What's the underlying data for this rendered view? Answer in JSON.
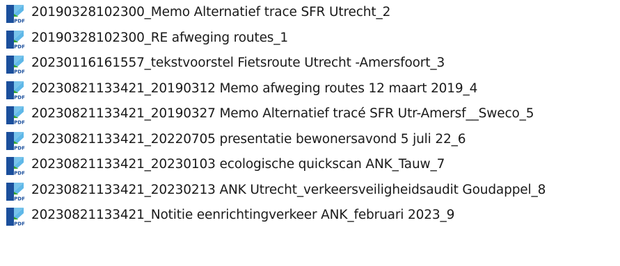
{
  "files": [
    {
      "name": "20190328102300_Memo Alternatief trace SFR Utrecht_2",
      "icon": "pdf-file-icon"
    },
    {
      "name": "20190328102300_RE afweging routes_1",
      "icon": "pdf-file-icon"
    },
    {
      "name": "20230116161557_tekstvoorstel Fietsroute Utrecht -Amersfoort_3",
      "icon": "pdf-file-icon"
    },
    {
      "name": "20230821133421_20190312 Memo afweging routes 12 maart 2019_4",
      "icon": "pdf-file-icon"
    },
    {
      "name": "20230821133421_20190327 Memo Alternatief tracé SFR Utr-Amersf__Sweco_5",
      "icon": "pdf-file-icon"
    },
    {
      "name": "20230821133421_20220705 presentatie bewonersavond 5 juli 22_6",
      "icon": "pdf-file-icon"
    },
    {
      "name": "20230821133421_20230103 ecologische quickscan ANK_Tauw_7",
      "icon": "pdf-file-icon"
    },
    {
      "name": "20230821133421_20230213 ANK Utrecht_verkeersveiligheidsaudit Goudappel_8",
      "icon": "pdf-file-icon"
    },
    {
      "name": "20230821133421_Notitie eenrichtingverkeer ANK_februari 2023_9",
      "icon": "pdf-file-icon"
    }
  ],
  "icon": {
    "badge_text": "PDF",
    "colors": {
      "dark_blue": "#1b4f9c",
      "light_blue": "#5fb8e8",
      "green": "#3aa935",
      "badge": "#ffffff"
    }
  }
}
